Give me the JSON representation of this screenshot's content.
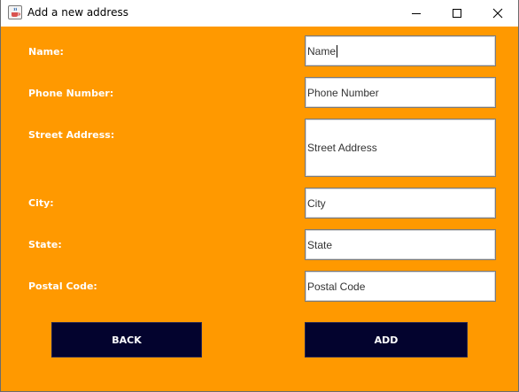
{
  "window": {
    "title": "Add a new address",
    "icon": "java-coffee-icon",
    "controls": [
      "minimize-icon",
      "maximize-icon",
      "close-icon"
    ]
  },
  "form": {
    "labels": {
      "name": "Name:",
      "phone": "Phone Number:",
      "street": "Street Address:",
      "city": "City:",
      "state": "State:",
      "postal": "Postal Code:"
    },
    "fields": {
      "name": "Name",
      "phone": "Phone Number",
      "street": "Street Address",
      "city": "City",
      "state": "State",
      "postal": "Postal Code"
    }
  },
  "buttons": {
    "back": "BACK",
    "add": "ADD"
  },
  "colors": {
    "background": "#ff9900",
    "button": "#03032e",
    "label_text": "#ffffff"
  }
}
